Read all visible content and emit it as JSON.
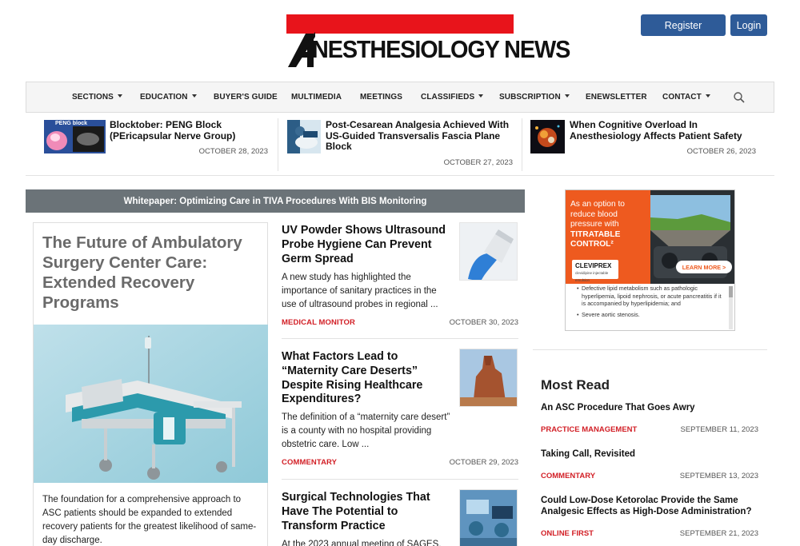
{
  "site": {
    "logo_text": "NESTHESIOLOGY NEWS",
    "logo_initial": "A"
  },
  "header": {
    "register_label": "Register",
    "login_label": "Login"
  },
  "nav": {
    "items": [
      {
        "label": "SECTIONS",
        "dropdown": true
      },
      {
        "label": "EDUCATION",
        "dropdown": true
      },
      {
        "label": "BUYER'S GUIDE",
        "dropdown": false
      },
      {
        "label": "MULTIMEDIA",
        "dropdown": false
      },
      {
        "label": "MEETINGS",
        "dropdown": false
      },
      {
        "label": "CLASSIFIEDS",
        "dropdown": true
      },
      {
        "label": "SUBSCRIPTION",
        "dropdown": true
      },
      {
        "label": "ENEWSLETTER",
        "dropdown": false
      },
      {
        "label": "CONTACT",
        "dropdown": true
      }
    ],
    "search_icon": "search-icon"
  },
  "top_strip": [
    {
      "title": "Blocktober: PENG Block (PEricapsular Nerve Group)",
      "date": "OCTOBER 28, 2023",
      "thumb_label": "PENG block"
    },
    {
      "title": "Post-Cesarean Analgesia Achieved With US-Guided Transversalis Fascia Plane Block",
      "date": "OCTOBER 27, 2023"
    },
    {
      "title": "When Cognitive Overload In Anesthesiology Affects Patient Safety",
      "date": "OCTOBER 26, 2023"
    }
  ],
  "whitepaper": {
    "label": "Whitepaper: Optimizing Care in TIVA Procedures With BIS Monitoring"
  },
  "feature": {
    "title": "The Future of Ambulatory Surgery Center Care: Extended Recovery Programs",
    "excerpt": "The foundation for a comprehensive approach to ASC patients should be expanded to extended recovery patients for the greatest likelihood of same-day discharge."
  },
  "articles": [
    {
      "title": "UV Powder Shows Ultrasound Probe Hygiene Can Prevent Germ Spread",
      "excerpt": "A new study has highlighted the importance of sanitary practices in the use of ultrasound probes in regional ...",
      "category": "MEDICAL MONITOR",
      "date": "OCTOBER 30, 2023"
    },
    {
      "title": "What Factors Lead to “Maternity Care Deserts” Despite Rising Healthcare Expenditures?",
      "excerpt": "The definition of a “maternity care desert” is a county with no hospital providing obstetric care. Low ...",
      "category": "COMMENTARY",
      "date": "OCTOBER 29, 2023"
    },
    {
      "title": "Surgical Technologies That Have The Potential to Transform Practice",
      "excerpt": "At the 2023 annual meeting of SAGES,"
    }
  ],
  "ad": {
    "headline_1": "As an option to reduce blood pressure with",
    "headline_2": "TITRATABLE CONTROL²",
    "brand": "CLEVIPREX",
    "brand_sub": "clevidipine injectable emulsion",
    "cta": "LEARN MORE >",
    "body_1": "Defective lipid metabolism such as pathologic hyperlipemia, lipoid nephrosis, or acute pancreatitis if it is accompanied by hyperlipidemia; and",
    "body_2": "Severe aortic stenosis."
  },
  "most_read": {
    "heading": "Most Read",
    "items": [
      {
        "title": "An ASC Procedure That Goes Awry",
        "category": "PRACTICE MANAGEMENT",
        "date": "SEPTEMBER 11, 2023"
      },
      {
        "title": "Taking Call, Revisited",
        "category": "COMMENTARY",
        "date": "SEPTEMBER 13, 2023"
      },
      {
        "title": "Could Low-Dose Ketorolac Provide the Same Analgesic Effects as High-Dose Administration?",
        "category": "ONLINE FIRST",
        "date": "SEPTEMBER 21, 2023"
      }
    ]
  },
  "colors": {
    "brand_red": "#e8141b",
    "button_blue": "#2e5b98",
    "category_red": "#d21f26",
    "banner_gray": "#6b7378",
    "ad_orange": "#ee5a1f"
  }
}
